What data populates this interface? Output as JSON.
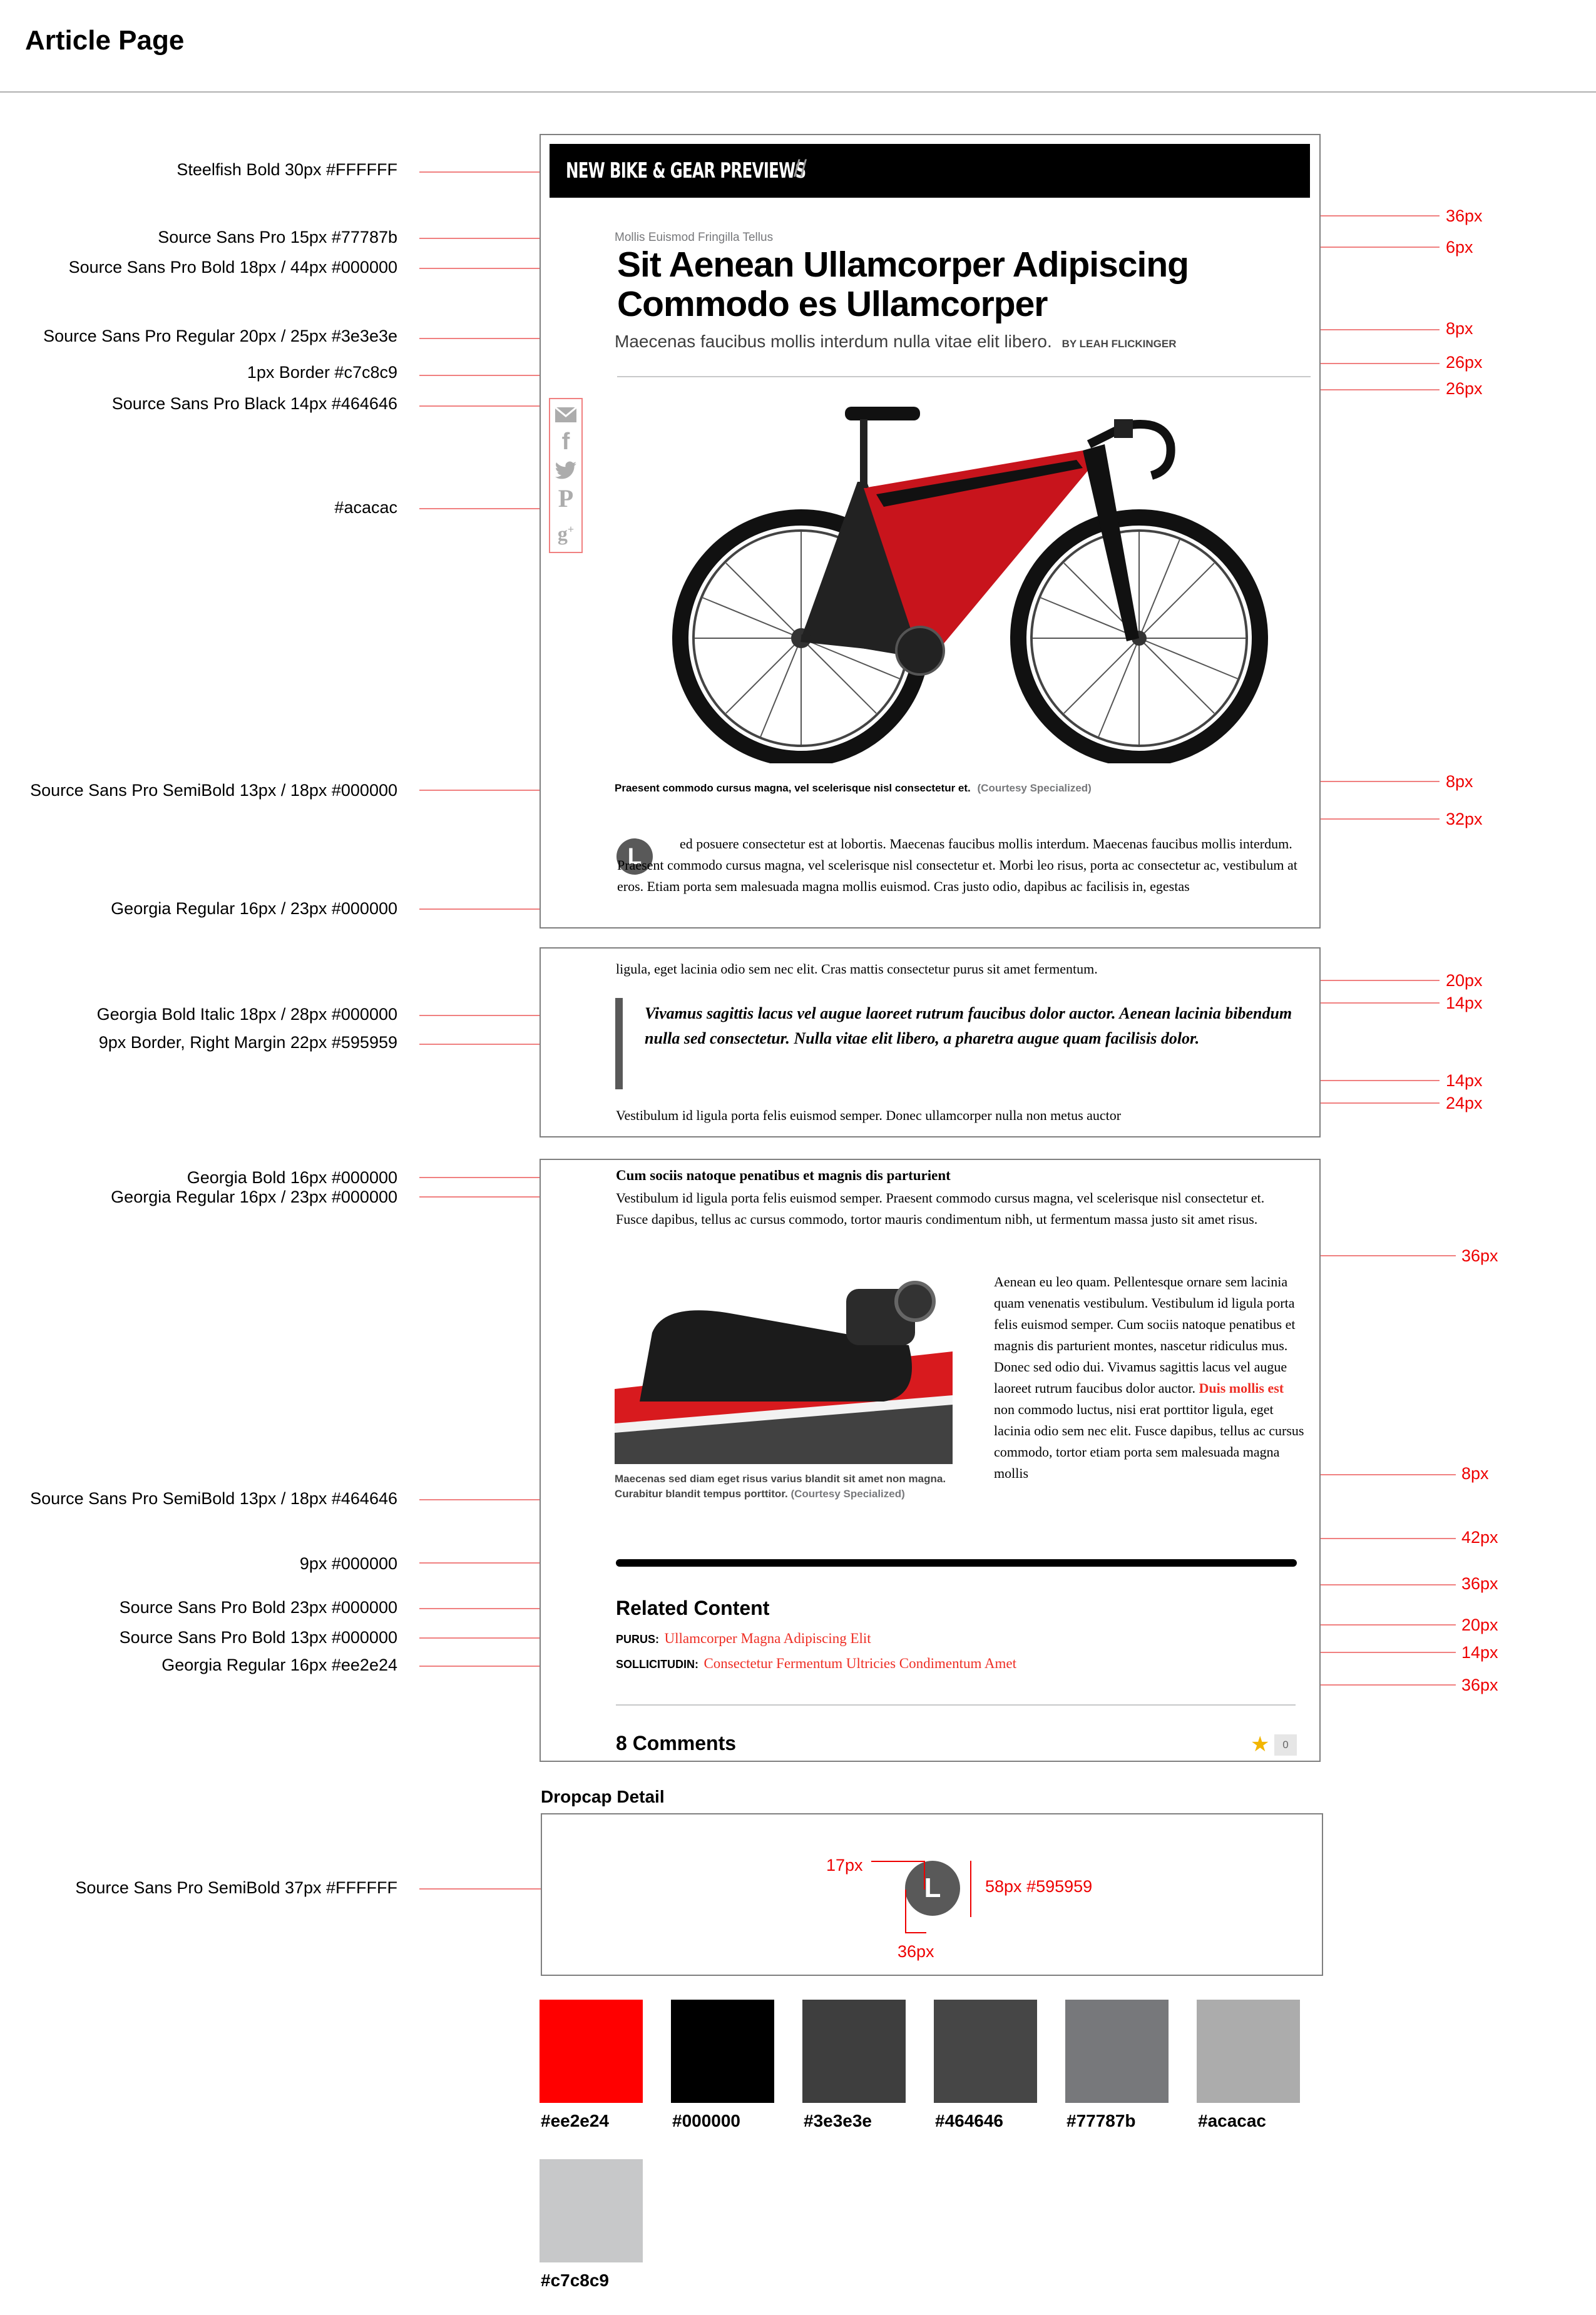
{
  "page_title": "Article Page",
  "annotations_left": [
    "Steelfish Bold 30px #FFFFFF",
    "Source Sans Pro 15px #77787b",
    "Source Sans Pro Bold 18px / 44px #000000",
    "Source Sans Pro Regular 20px / 25px #3e3e3e",
    "1px Border #c7c8c9",
    "Source Sans Pro Black 14px #464646",
    "#acacac",
    "Source Sans Pro SemiBold 13px / 18px #000000",
    "Georgia Regular 16px / 23px #000000",
    "Georgia Bold Italic 18px / 28px #000000",
    "9px Border, Right Margin  22px #595959",
    "Georgia Bold 16px #000000",
    "Georgia Regular 16px / 23px #000000",
    "Source Sans Pro SemiBold 13px / 18px #464646",
    "9px #000000",
    "Source Sans Pro Bold 23px #000000",
    "Source Sans Pro Bold 13px #000000",
    "Georgia Regular 16px #ee2e24",
    "Source Sans Pro SemiBold 37px #FFFFFF"
  ],
  "annotations_right": [
    "36px",
    "6px",
    "8px",
    "26px",
    "26px",
    "8px",
    "32px",
    "20px",
    "14px",
    "14px",
    "24px",
    "36px",
    "8px",
    "42px",
    "36px",
    "20px",
    "14px",
    "36px"
  ],
  "article": {
    "section_banner": "NEW BIKE & GEAR PREVIEWS",
    "banner_slashes": "//",
    "kicker": "Mollis Euismod Fringilla Tellus",
    "headline": "Sit Aenean Ullamcorper Adipiscing Commodo es Ullamcorper",
    "dek": "Maecenas faucibus mollis interdum nulla vitae elit libero.",
    "byline": "BY LEAH FLICKINGER",
    "share_icons": [
      "mail-icon",
      "facebook-icon",
      "twitter-icon",
      "pinterest-icon",
      "google-plus-icon"
    ],
    "caption_main": "Praesent commodo cursus magna, vel scelerisque nisl consectetur et.",
    "caption_credit": "(Courtesy Specialized)",
    "dropcap": "L",
    "para1": "ed posuere consectetur est at lobortis. Maecenas faucibus mollis interdum. Maecenas faucibus mollis interdum. Praesent commodo cursus magna, vel scelerisque nisl consectetur et. Morbi leo risus, porta ac consectetur ac, vestibulum at eros. Etiam porta sem malesuada magna mollis euismod. Cras justo odio, dapibus ac facilisis in, egestas",
    "para1_cont": "ligula, eget lacinia odio sem nec elit. Cras mattis consectetur purus sit amet fermentum.",
    "pullquote": "Vivamus sagittis lacus vel augue laoreet rutrum faucibus dolor auctor. Aenean lacinia bibendum nulla sed consectetur. Nulla vitae elit libero, a pharetra augue quam facilisis dolor.",
    "para2": "Vestibulum id ligula porta felis euismod semper. Donec ullamcorper nulla non metus auctor",
    "subhead": "Cum sociis natoque penatibus et magnis dis parturient",
    "para3": "Vestibulum id ligula porta felis euismod semper. Praesent commodo cursus magna, vel scelerisque nisl consectetur et. Fusce dapibus, tellus ac cursus commodo, tortor mauris condimentum nibh, ut fermentum massa justo sit amet risus.",
    "para4_a": "Aenean eu leo quam. Pellentesque ornare sem lacinia quam venenatis vestibulum. Vestibulum id ligula porta felis euismod semper. Cum sociis natoque penatibus et magnis dis parturient montes, nascetur ridiculus mus. Donec sed odio dui. Vivamus sagittis lacus vel augue laoreet rutrum faucibus dolor auctor.",
    "para4_link": "Duis mollis est",
    "para4_b": "non commodo luctus, nisi erat porttitor ligula, eget lacinia odio sem nec elit. Fusce dapibus, tellus ac cursus commodo, tortor etiam porta sem malesuada magna mollis",
    "caption2": "Maecenas sed diam eget risus varius blandit sit amet non magna. Curabitur blandit tempus porttitor.",
    "caption2_credit": "(Courtesy Specialized)",
    "related_title": "Related Content",
    "related": [
      {
        "label": "PURUS:",
        "link": "Ullamcorper Magna Adipiscing Elit"
      },
      {
        "label": "SOLLICITUDIN:",
        "link": "Consectetur Fermentum Ultricies Condimentum Amet"
      }
    ],
    "comments": "8 Comments",
    "comment_count_badge": "0"
  },
  "dropcap_detail": {
    "title": "Dropcap Detail",
    "letter": "L",
    "dim_17": "17px",
    "dim_36": "36px",
    "dim_58": "58px #595959"
  },
  "swatches": [
    {
      "hex": "#ee2e24",
      "label": "#ee2e24",
      "display": "#ff0000"
    },
    {
      "hex": "#000000",
      "label": "#000000",
      "display": "#000000"
    },
    {
      "hex": "#3e3e3e",
      "label": "#3e3e3e",
      "display": "#3e3e3e"
    },
    {
      "hex": "#464646",
      "label": "#464646",
      "display": "#464646"
    },
    {
      "hex": "#77787b",
      "label": "#77787b",
      "display": "#77787b"
    },
    {
      "hex": "#acacac",
      "label": "#acacac",
      "display": "#acacac"
    },
    {
      "hex": "#c7c8c9",
      "label": "#c7c8c9",
      "display": "#c7c8c9"
    }
  ]
}
